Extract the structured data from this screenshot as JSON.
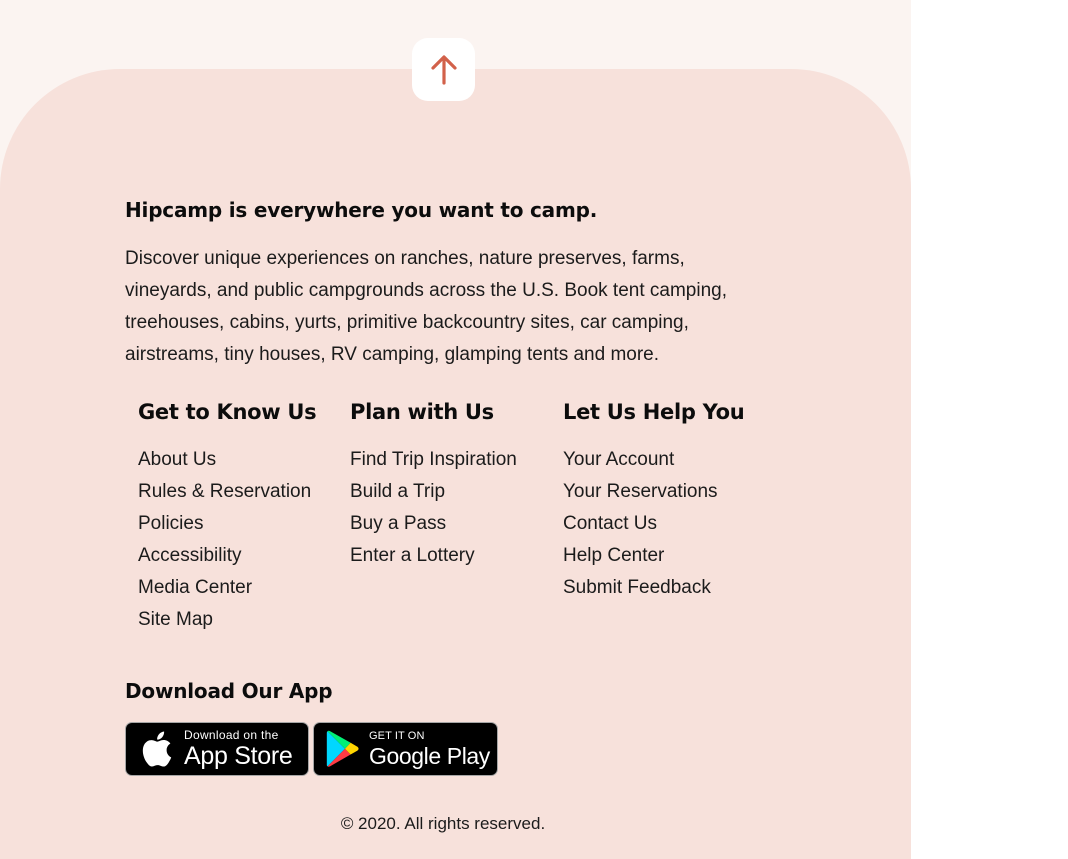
{
  "back_to_top": {
    "icon": "arrow-up-icon",
    "color": "#d2614a"
  },
  "intro": {
    "headline": "Hipcamp is everywhere you want to camp.",
    "description": "Discover unique experiences on ranches, nature preserves, farms, vineyards, and public campgrounds across the U.S. Book tent camping, treehouses, cabins, yurts, primitive backcountry sites, car camping, airstreams, tiny houses, RV camping, glamping tents and more."
  },
  "columns": [
    {
      "heading": "Get to Know Us",
      "links": [
        "About Us",
        "Rules & Reservation",
        "Policies",
        "Accessibility",
        "Media Center",
        "Site Map"
      ]
    },
    {
      "heading": "Plan with Us",
      "links": [
        "Find Trip Inspiration",
        "Build a Trip",
        "Buy a Pass",
        "Enter a Lottery"
      ]
    },
    {
      "heading": "Let Us Help You",
      "links": [
        "Your Account",
        "Your Reservations",
        "Contact Us",
        "Help Center",
        "Submit Feedback"
      ]
    }
  ],
  "app": {
    "heading": "Download Our App",
    "app_store": {
      "small": "Download on the",
      "big": "App Store",
      "icon": "apple-icon"
    },
    "google_play": {
      "small": "GET IT ON",
      "big": "Google Play",
      "icon": "google-play-icon"
    }
  },
  "copyright": "© 2020. All rights reserved.",
  "colors": {
    "page_band": "#fbf4f1",
    "footer_bg": "#f7e1db",
    "text": "#1b1b1b",
    "accent": "#d2614a"
  }
}
